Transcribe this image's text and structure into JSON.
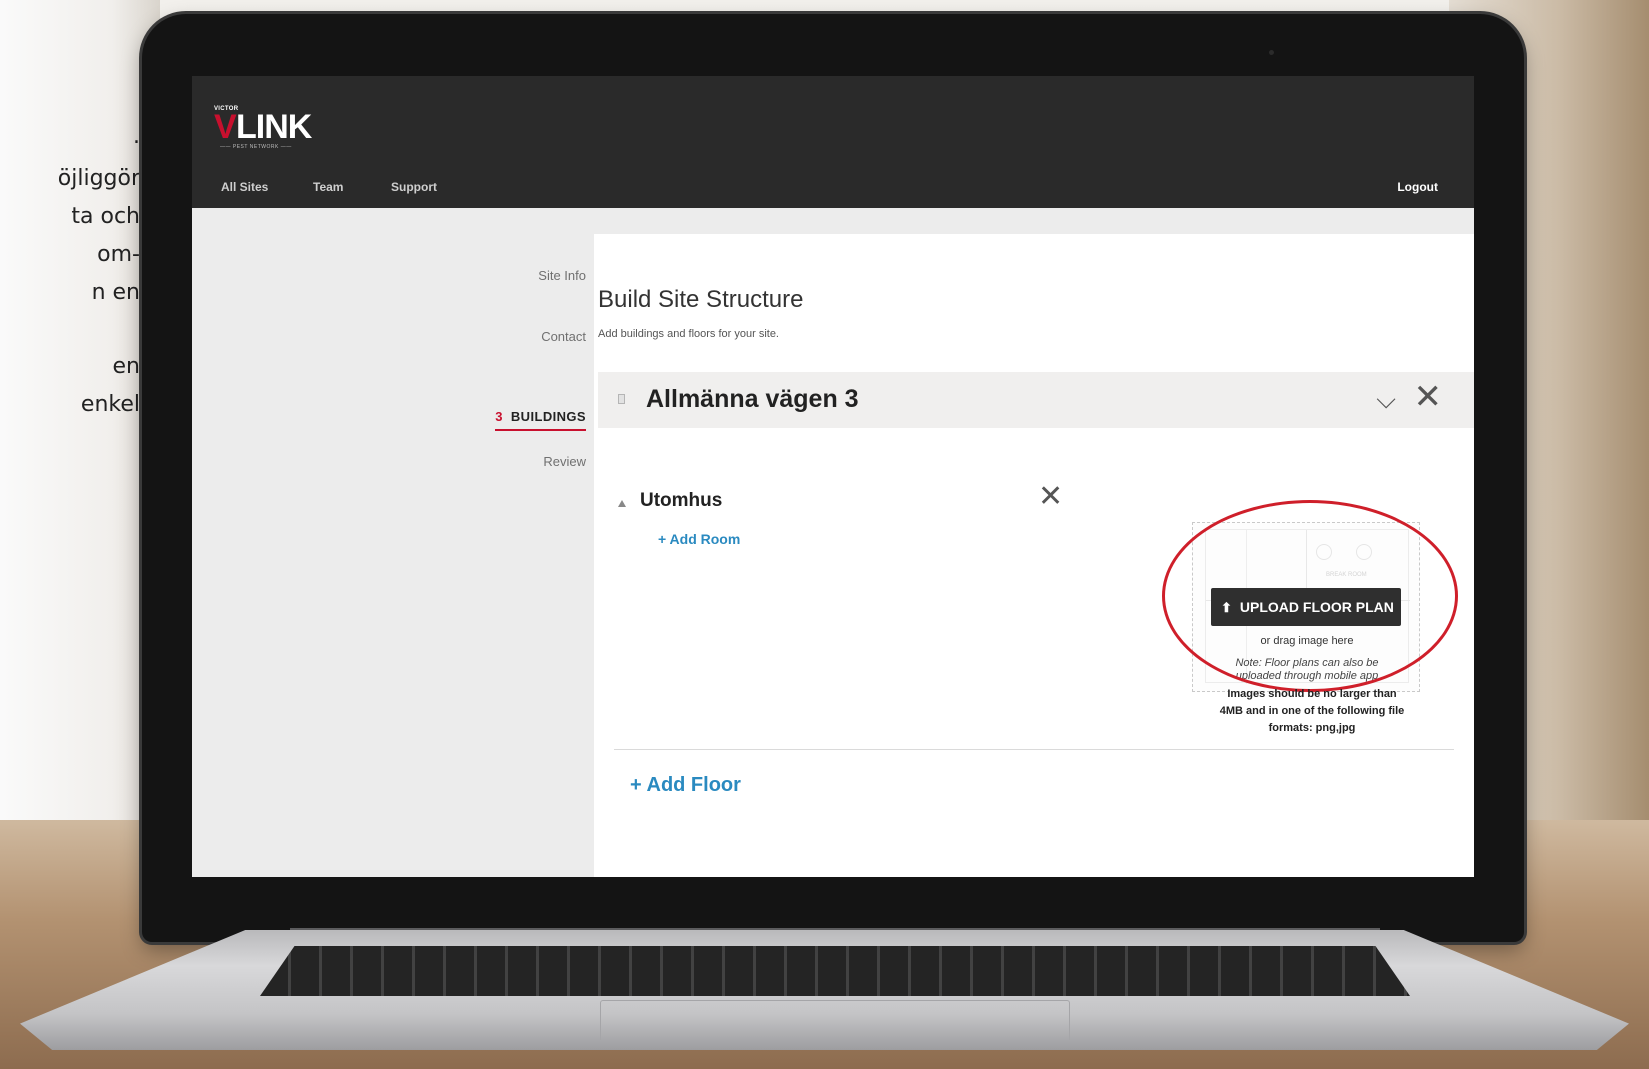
{
  "left_copy": [
    ".",
    "öjliggör",
    "ta och",
    "om-",
    "n en",
    "",
    "en",
    "enkel"
  ],
  "brand": {
    "victor": "VICTOR",
    "v": "V",
    "link": "LINK",
    "tagline": "PEST NETWORK",
    "red": "#c8102e"
  },
  "nav": {
    "items": [
      "All Sites",
      "Team",
      "Support"
    ],
    "logout": "Logout"
  },
  "wizard": {
    "site_info": "Site Info",
    "contact": "Contact",
    "buildings_num": "3",
    "buildings": "BUILDINGS",
    "review": "Review"
  },
  "main": {
    "title": "Build Site Structure",
    "subtitle": "Add buildings and floors for your site.",
    "building": {
      "name": "Allmänna vägen 3",
      "expand_icon": "chevron-down-icon",
      "close_icon": "close-icon"
    },
    "floor": {
      "name": "Utomhus",
      "add_room": "+ Add Room"
    },
    "upload": {
      "watermark": "BREAK ROOM",
      "button": "UPLOAD FLOOR PLAN",
      "drag": "or drag image here",
      "note_line1": "Note: Floor plans can also be",
      "note_line2": "uploaded through mobile app",
      "size_line1": "Images should be no larger than",
      "size_line2": "4MB and in one of the following file",
      "size_line3": "formats: png,jpg"
    },
    "add_floor": "+ Add Floor"
  },
  "colors": {
    "link": "#2a8ac0",
    "topbar": "#2a2a2a",
    "highlight": "#cf1f2a"
  }
}
